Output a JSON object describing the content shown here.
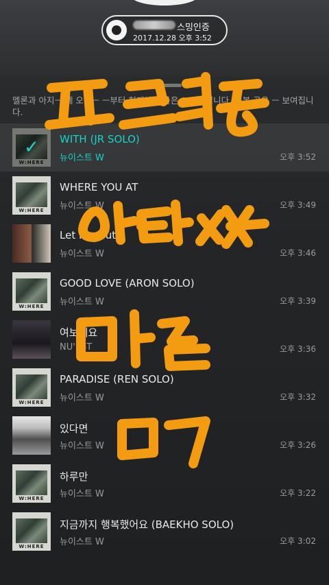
{
  "badge": {
    "title": "스밍인증",
    "date": "2017.12.28 오후 3:52"
  },
  "notice": "멜론과 아지ㅡ 세 오늘ㅡ ㅡ부터 현재까지 들은 100곡입니다. 중복 곡은 ㅡ 보여집니다.",
  "tracks": [
    {
      "title": "WITH (JR SOLO)",
      "artist": "뉴이스트 W",
      "time": "오후 3:52",
      "art": "wh",
      "active": true
    },
    {
      "title": "WHERE YOU AT",
      "artist": "뉴이스트 W",
      "time": "오후 3:49",
      "art": "wh"
    },
    {
      "title": "Let Me Out",
      "artist": "뉴이스트 W",
      "time": "오후 3:46",
      "art": "letme"
    },
    {
      "title": "GOOD LOVE (ARON SOLO)",
      "artist": "뉴이스트 W",
      "time": "오후 3:39",
      "art": "wh"
    },
    {
      "title": "여보세요",
      "artist": "NU'EST",
      "time": "오후 3:36",
      "art": "nuest"
    },
    {
      "title": "PARADISE (REN SOLO)",
      "artist": "뉴이스트 W",
      "time": "오후 3:32",
      "art": "wh"
    },
    {
      "title": "있다면",
      "artist": "뉴이스트 W",
      "time": "오후 3:26",
      "art": "bw"
    },
    {
      "title": "하루만",
      "artist": "뉴이스트 W",
      "time": "오후 3:22",
      "art": "wh"
    },
    {
      "title": "지금까지 행복했어요 (BAEKHO SOLO)",
      "artist": "뉴이스트 W",
      "time": "오후 3:02",
      "art": "wh"
    }
  ],
  "album_logo": "W:HERE",
  "icons": {
    "check": "check-icon",
    "disc": "disc-icon"
  },
  "colors": {
    "accent": "#19d3c8",
    "graffiti": "#f39c12"
  },
  "overlay_text": [
    "팬투저용",
    "이터사",
    "마글",
    "ㅁㄱ"
  ]
}
